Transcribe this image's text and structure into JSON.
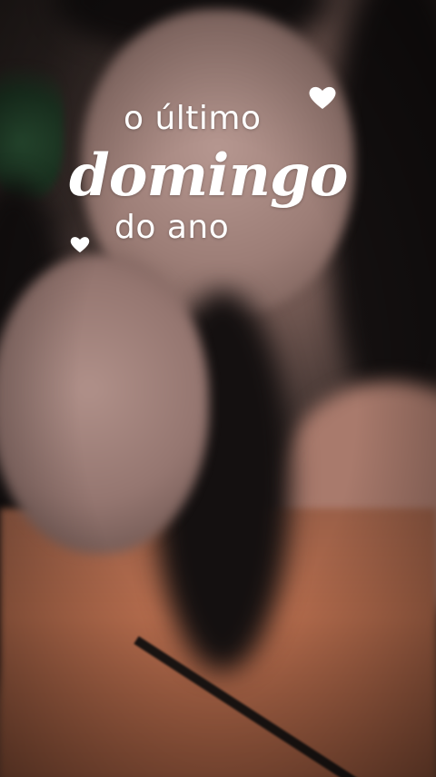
{
  "sticker": {
    "line1": "o último",
    "line2": "domingo",
    "line3": "do ano",
    "color": "#ffffff",
    "icons": [
      "heart-icon",
      "heart-icon"
    ]
  }
}
